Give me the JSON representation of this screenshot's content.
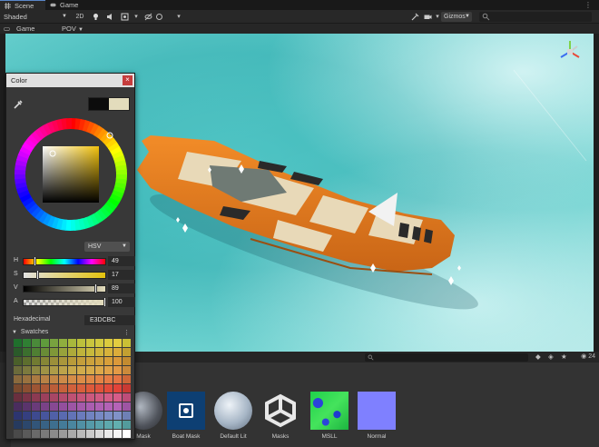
{
  "tabs": [
    {
      "label": "Scene",
      "icon": "hash-icon"
    },
    {
      "label": "Game",
      "icon": "gamepad-icon"
    }
  ],
  "scene_toolbar": {
    "shading_mode": "Shaded",
    "mode_2d": "2D",
    "gizmos": "Gizmos",
    "search_icon": "search-icon"
  },
  "game_bar": {
    "game_label": "Game",
    "camera_label": "POV"
  },
  "color_picker": {
    "title": "Color",
    "mode": "HSV",
    "old_color": "#0c0c0c",
    "new_color": "#E3DCBC",
    "channels": [
      {
        "label": "H",
        "value": "49",
        "fraction": 0.14
      },
      {
        "label": "S",
        "value": "17",
        "fraction": 0.17
      },
      {
        "label": "V",
        "value": "89",
        "fraction": 0.89
      },
      {
        "label": "A",
        "value": "100",
        "fraction": 1.0
      }
    ],
    "hex_label": "Hexadecimal",
    "hex_value": "E3DCBC",
    "swatches_label": "Swatches",
    "swatch_colors": [
      "#1f6f2c",
      "#2f7f33",
      "#4a8a3a",
      "#5f9b3c",
      "#78a23f",
      "#8fae3e",
      "#a8b83c",
      "#bcc03c",
      "#c9c53e",
      "#d2c93f",
      "#dccb3e",
      "#e3cd40",
      "#cac035",
      "#2a5a2a",
      "#3b6f2e",
      "#4f7f33",
      "#698c36",
      "#7f9738",
      "#98a23b",
      "#aeaa3a",
      "#bfb33b",
      "#c7b93c",
      "#cfb53c",
      "#d7b23b",
      "#dcad3a",
      "#c3a031",
      "#4a5f2a",
      "#5d6e2e",
      "#717b32",
      "#868636",
      "#9b8f3a",
      "#aa963b",
      "#b99b3a",
      "#c49e3b",
      "#cca23c",
      "#d1a23c",
      "#d89f3a",
      "#db993a",
      "#c38b30",
      "#6b6b3b",
      "#7c7a3e",
      "#8e8842",
      "#9f9345",
      "#ae9c48",
      "#bda34a",
      "#c9a94b",
      "#d1ab4b",
      "#d7ab4a",
      "#dca849",
      "#e0a248",
      "#e39a46",
      "#cb8a3b",
      "#8a6a3d",
      "#9a723f",
      "#aa7a42",
      "#b88245",
      "#c38646",
      "#cd8a48",
      "#d58d48",
      "#db8c47",
      "#e08846",
      "#e38345",
      "#e57c44",
      "#e67443",
      "#cf6638",
      "#7a4a2e",
      "#8c4f31",
      "#9d5534",
      "#ad5a37",
      "#bb5e39",
      "#c7613b",
      "#d1613c",
      "#d85f3c",
      "#dd5a3b",
      "#e0533a",
      "#e24b3a",
      "#e34339",
      "#c93a33",
      "#6a2f3e",
      "#7b3448",
      "#8c3a52",
      "#9b405c",
      "#a84665",
      "#b44c6d",
      "#be5173",
      "#c65579",
      "#cc587e",
      "#d15a82",
      "#d45c86",
      "#d65c89",
      "#bd4d79",
      "#4a2d5e",
      "#5a346c",
      "#6a3b7a",
      "#7a4287",
      "#874993",
      "#934f9d",
      "#9d55a5",
      "#a55aab",
      "#ab5db0",
      "#b060b3",
      "#b362b6",
      "#b563b8",
      "#9e55a3",
      "#2d3570",
      "#353f80",
      "#3e4a8f",
      "#47559c",
      "#5060a7",
      "#596ab0",
      "#6273b7",
      "#6a7bbd",
      "#7183c1",
      "#7789c4",
      "#7c8ec6",
      "#8092c8",
      "#6e80b5",
      "#263a5e",
      "#2c476c",
      "#325579",
      "#386285",
      "#3e6f8f",
      "#447b98",
      "#4a869f",
      "#5090a4",
      "#559aa8",
      "#5aa2ab",
      "#5ea9ad",
      "#62afaf",
      "#539b9c",
      "#4a4a4a",
      "#5a5a5a",
      "#6a6a6a",
      "#7a7a7a",
      "#8a8a8a",
      "#9a9a9a",
      "#aaaaaa",
      "#bababa",
      "#cacaca",
      "#dadada",
      "#eaeaea",
      "#f6f6f6",
      "#ffffff"
    ]
  },
  "project": {
    "item_count": "24",
    "assets": [
      {
        "label": "Mask",
        "icon": "sphere-dark-icon"
      },
      {
        "label": "Boat Mask",
        "icon": "boat-mask-icon"
      },
      {
        "label": "Default Lit",
        "icon": "material-sphere-icon"
      },
      {
        "label": "Masks",
        "icon": "unity-logo-icon"
      },
      {
        "label": "MSLL",
        "icon": "msll-texture-icon"
      },
      {
        "label": "Normal",
        "icon": "normal-map-icon"
      }
    ]
  }
}
